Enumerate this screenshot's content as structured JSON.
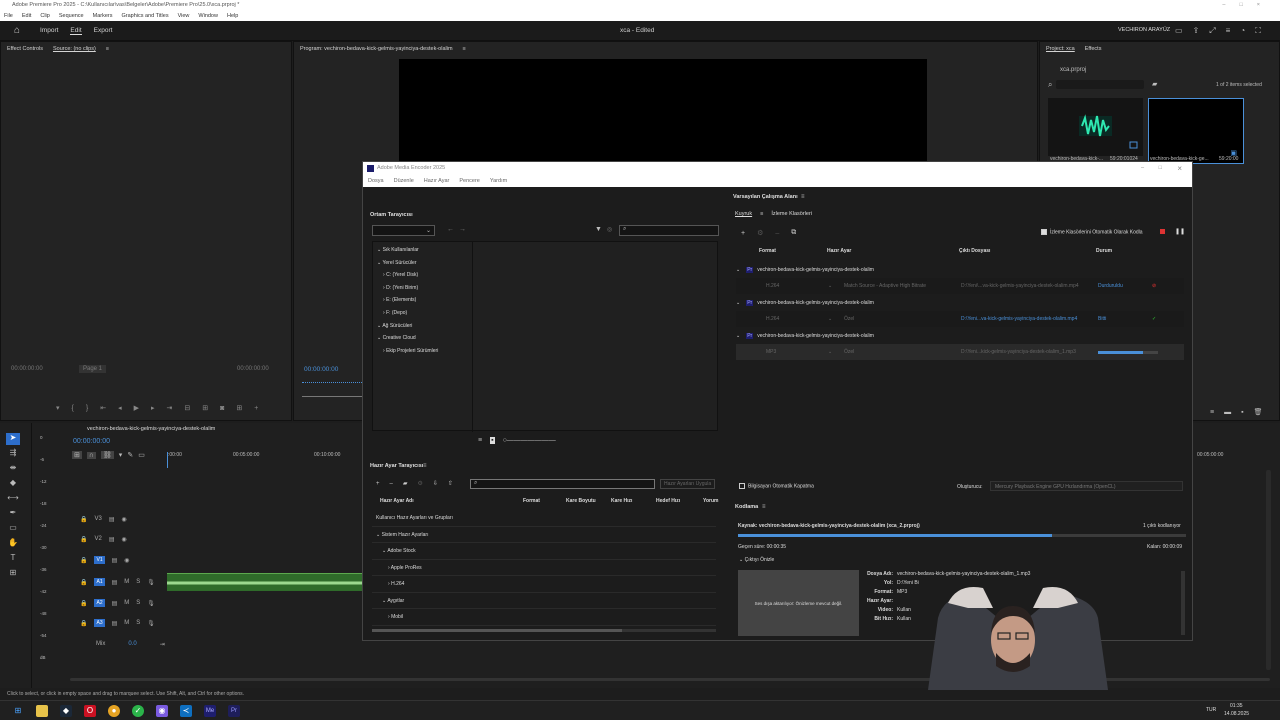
{
  "premiere": {
    "window_title": "Adobe Premiere Pro 2025 - C:\\Kullanıcılar\\vas\\Belgeler\\Adobe\\Premiere Pro\\25.0\\xca.prproj *",
    "menu": [
      "File",
      "Edit",
      "Clip",
      "Sequence",
      "Markers",
      "Graphics and Titles",
      "View",
      "Window",
      "Help"
    ],
    "workspace_tabs": [
      "Import",
      "Edit",
      "Export"
    ],
    "active_workspace": "Edit",
    "project_title": "xca - Edited",
    "user": "VECHIRON ARAYÜZ",
    "source_tabs": [
      "Effect Controls",
      "Source: (no clips)"
    ],
    "source_timecode_left": "00:00:00:00",
    "source_page": "Page 1",
    "source_timecode_right": "00:00:00:00",
    "program_tab": "Program: vechiron-bedava-kick-gelmis-yayinciya-destek-olalim",
    "program_timecode": "00:00:00:00",
    "project_tabs": [
      "Project: xca",
      "Effects"
    ],
    "project_file": "xca.prproj",
    "items_selected": "1 of 2 items selected",
    "project_items": [
      {
        "name": "vechiron-bedava-kick-...",
        "duration": "59:20:01024"
      },
      {
        "name": "vechiron-bedava-kick-ge...",
        "duration": "59:20:00"
      }
    ],
    "timeline_tab": "vechiron-bedava-kick-gelmis-yayinciya-destek-olalim",
    "timeline_timecode": "00:00:00:00",
    "ruler": [
      ":00:00",
      "00:05:00:00",
      "00:10:00:00",
      "00:05:00:00"
    ],
    "meter_labels": [
      "0",
      "-6",
      "-12",
      "-18",
      "-24",
      "-30",
      "-36",
      "-42",
      "-48",
      "-54",
      "dB"
    ],
    "video_tracks": [
      "V3",
      "V2",
      "V1"
    ],
    "audio_tracks": [
      "A1",
      "A2",
      "A3"
    ],
    "mix_label": "Mix",
    "mix_value": "0.0",
    "status": "Click to select, or click in empty space and drag to marquee select. Use Shift, Alt, and Ctrl for other options."
  },
  "encoder": {
    "window_title": "Adobe Media Encoder 2025",
    "menu": [
      "Dosya",
      "Düzenle",
      "Hazır Ayar",
      "Pencere",
      "Yardım"
    ],
    "media_browser": "Ortam Tarayıcısı",
    "tree": [
      {
        "label": "Sık Kullanılanlar",
        "level": 0,
        "caret": "down"
      },
      {
        "label": "Yerel Sürücüler",
        "level": 0,
        "caret": "down"
      },
      {
        "label": "C: (Yerel Disk)",
        "level": 1,
        "caret": "right"
      },
      {
        "label": "D: (Yeni Birim)",
        "level": 1,
        "caret": "right"
      },
      {
        "label": "E: (Elements)",
        "level": 1,
        "caret": "right"
      },
      {
        "label": "F: (Depo)",
        "level": 1,
        "caret": "right"
      },
      {
        "label": "Ağ Sürücüleri",
        "level": 0,
        "caret": "down"
      },
      {
        "label": "Creative Cloud",
        "level": 0,
        "caret": "down"
      },
      {
        "label": "Ekip Projeleri Sürümleri",
        "level": 1,
        "caret": "right"
      }
    ],
    "workspace": "Varsayılan Çalışma Alanı",
    "queue_tabs": [
      "Kuyruk",
      "İzleme Klasörleri"
    ],
    "auto_encode": "İzleme Klasörlerini Otomatik Olarak Kodla",
    "columns": [
      "Format",
      "Hazır Ayar",
      "Çıktı Dosyası",
      "Durum"
    ],
    "jobs": [
      {
        "name": "vechiron-bedava-kick-gelmis-yayinciya-destek-olalim",
        "format": "H.264",
        "preset": "Match Source - Adaptive High Bitrate",
        "output": "D:\\Yeni\\...va-kick-gelmis-yayinciya-destek-olalim.mp4",
        "status": "Durduruldu"
      },
      {
        "name": "vechiron-bedava-kick-gelmis-yayinciya-destek-olalim",
        "format": "H.264",
        "preset": "Özel",
        "output": "D:\\Yeni...va-kick-gelmis-yayinciya-destek-olalim.mp4",
        "status": "Bitti"
      },
      {
        "name": "vechiron-bedava-kick-gelmis-yayinciya-destek-olalim",
        "format": "MP3",
        "preset": "Özel",
        "output": "D:\\Yeni...kick-gelmis-yayinciya-destek-olalim_1.mp3",
        "status": "",
        "progress": 0.75
      }
    ],
    "shutdown_label": "Bilgisayarı Otomatik Kapatma",
    "renderer_label": "Oluşturucu:",
    "renderer": "Mercury Playback Engine GPU Hızlandırma (OpenCL)",
    "preset_browser": "Hazır Ayar Tarayıcısı",
    "apply_preset": "Hazır Ayarları Uygula",
    "preset_columns": [
      "Hazır Ayar Adı",
      "Format",
      "Kare Boyutu",
      "Kare Hızı",
      "Hedef Hızı",
      "Yorum"
    ],
    "presets": [
      {
        "label": "Kullanıcı Hazır Ayarları ve Grupları",
        "level": 0
      },
      {
        "label": "Sistem Hazır Ayarları",
        "level": 0
      },
      {
        "label": "Adobe Stock",
        "level": 1
      },
      {
        "label": "Apple ProRes",
        "level": 2
      },
      {
        "label": "H.264",
        "level": 2
      },
      {
        "label": "Aygıtlar",
        "level": 1
      },
      {
        "label": "Mobil",
        "level": 2
      }
    ],
    "encoding_title": "Kodlama",
    "source": "Kaynak: vechiron-bedava-kick-gelmis-yayinciya-destek-olalim (xca_2.prproj)",
    "outputs": "1 çıktı kodlanıyor",
    "elapsed": "Geçen süre: 00:00:35",
    "remaining": "Kalan: 00:00:09",
    "progress": 0.7,
    "output_preview": "Çıktıyı Önizle",
    "preview_msg": "Ses dışa aktarılıyor: Önizleme mevcut değil.",
    "details": [
      {
        "k": "Dosya Adı:",
        "v": "vechiron-bedava-kick-gelmis-yayinciya-destek-olalim_1.mp3"
      },
      {
        "k": "Yol:",
        "v": "D:\\Yeni Bi"
      },
      {
        "k": "Format:",
        "v": "MP3"
      },
      {
        "k": "Hazır Ayar:",
        "v": ""
      },
      {
        "k": "Video:",
        "v": "Kullan"
      },
      {
        "k": "Bit Hızı:",
        "v": "Kullan"
      }
    ]
  },
  "taskbar": {
    "lang": "TUR",
    "time": "01:35",
    "date": "14.08.2025"
  }
}
